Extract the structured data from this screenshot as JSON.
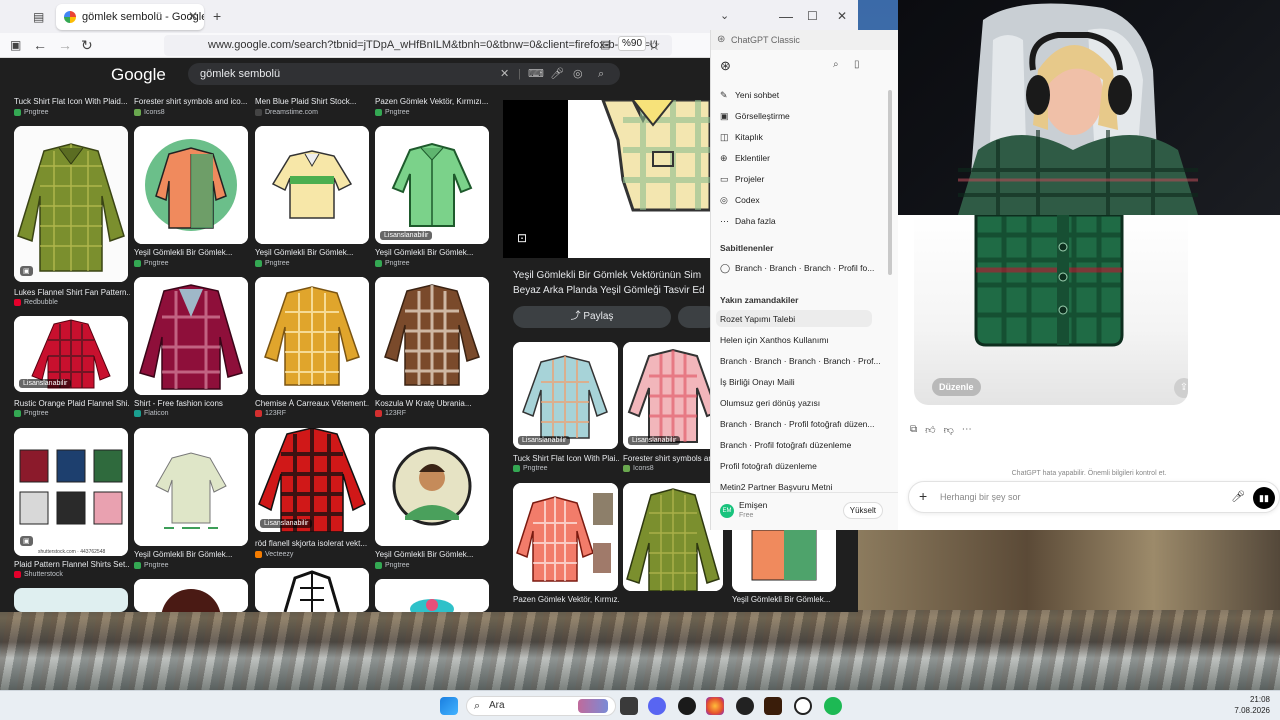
{
  "browser": {
    "tab_title": "gömlek sembolü - Google'da A",
    "url": "www.google.com/search?tbnid=jTDpA_wHfBnILM&tbnh=0&tbnw=0&client=firefox-b-d&hs=U",
    "zoom": "%90"
  },
  "google": {
    "logo": "Google",
    "query": "gömlek sembolü"
  },
  "results": {
    "top_captions": [
      {
        "title": "Tuck Shirt Flat Icon With Plaid...",
        "source": "Pngtree"
      },
      {
        "title": "Forester shirt symbols and ico...",
        "source": "Icons8"
      },
      {
        "title": "Men Blue Plaid Shirt Stock...",
        "source": "Dreamstime.com"
      },
      {
        "title": "Pazen Gömlek Vektör, Kırmızı...",
        "source": "Pngtree"
      }
    ],
    "col1": [
      {
        "title": "Lukes Flannel Shirt Fan Pattern...",
        "source": "Redbubble"
      },
      {
        "title": "Rustic Orange Plaid Flannel Shi...",
        "source": "Pngtree",
        "badge": "Lisanslanabilir"
      },
      {
        "title": "Plaid Pattern Flannel Shirts Set...",
        "source": "Shutterstock"
      }
    ],
    "col2": [
      {
        "title": "Yeşil Gömlekli Bir Gömlek...",
        "source": "Pngtree"
      },
      {
        "title": "Shirt - Free fashion icons",
        "source": "Flaticon"
      },
      {
        "title": "Yeşil Gömlekli Bir Gömlek...",
        "source": "Pngtree"
      }
    ],
    "col3": [
      {
        "title": "Yeşil Gömlekli Bir Gömlek...",
        "source": "Pngtree"
      },
      {
        "title": "Chemise À Carreaux Vêtement...",
        "source": "123RF"
      },
      {
        "title": "röd flanell skjorta isolerat vekt...",
        "source": "Vecteezy",
        "badge": "Lisanslanabilir"
      }
    ],
    "col4": [
      {
        "title": "Yeşil Gömlekli Bir Gömlek...",
        "source": "Pngtree",
        "badge": "Lisanslanabilir"
      },
      {
        "title": "Koszula W Kratę Ubrania...",
        "source": "123RF"
      },
      {
        "title": "Yeşil Gömlekli Bir Gömlek...",
        "source": "Pngtree"
      }
    ],
    "shutter_text": "shutterstock.com · 443762548"
  },
  "preview": {
    "title_line1": "Yeşil Gömlekli Bir Gömlek Vektörünün Sim",
    "title_line2": "Beyaz Arka Planda Yeşil Gömleği Tasvir Ed",
    "share": "Paylaş",
    "related": [
      {
        "title": "Tuck Shirt Flat Icon With Plai...",
        "source": "Pngtree",
        "badge": "Lisanslanabilir"
      },
      {
        "title": "Forester shirt symbols and...",
        "source": "Icons8",
        "badge": "Lisanslanabilir"
      },
      {
        "title": "Pazen Gömlek Vektör, Kırmız...",
        "source": ""
      },
      {
        "title": "",
        "source": ""
      },
      {
        "title": "Yeşil Gömlekli Bir Gömlek...",
        "source": ""
      }
    ]
  },
  "chatgpt": {
    "window_title": "ChatGPT Classic",
    "menu": [
      {
        "icon": "✎",
        "label": "Yeni sohbet"
      },
      {
        "icon": "▣",
        "label": "Görselleştirme"
      },
      {
        "icon": "◫",
        "label": "Kitaplık"
      },
      {
        "icon": "⊕",
        "label": "Eklentiler"
      },
      {
        "icon": "▭",
        "label": "Projeler"
      },
      {
        "icon": "◎",
        "label": "Codex"
      },
      {
        "icon": "⋯",
        "label": "Daha fazla"
      }
    ],
    "pinned_heading": "Sabitlenenler",
    "pinned": [
      "Branch · Branch · Branch · Profil fo..."
    ],
    "recent_heading": "Yakın zamandakiler",
    "recent": [
      "Rozet Yapımı Talebi",
      "Helen için Xanthos Kullanımı",
      "Branch · Branch · Branch · Branch · Prof...",
      "İş Birliği Onayı Maili",
      "Olumsuz geri dönüş yazısı",
      "Branch · Branch · Profil fotoğrafı düzen...",
      "Branch · Profil fotoğrafı düzenleme",
      "Profil fotoğrafı düzenleme",
      "Metin2 Partner Başvuru Metni"
    ],
    "user_name": "Emişen",
    "user_plan": "Free",
    "avatar_initials": "EM",
    "upgrade": "Yükselt",
    "edit_button": "Düzenle",
    "disclaimer": "ChatGPT hata yapabilir. Önemli bilgileri kontrol et.",
    "composer_placeholder": "Herhangi bir şey sor"
  },
  "taskbar": {
    "search_placeholder": "Ara",
    "time": "21:08",
    "date": "7.08.2026"
  },
  "colors": {
    "google_dark": "#1f1f1f",
    "accent_green": "#34a853",
    "flannel_green": "#1f6b45",
    "flannel_red": "#c8102e"
  }
}
